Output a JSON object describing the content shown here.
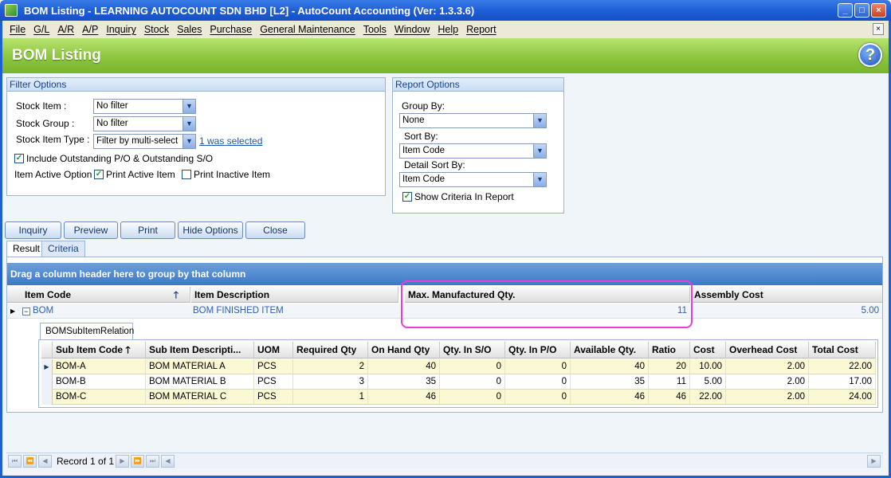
{
  "window": {
    "title": "BOM Listing - LEARNING AUTOCOUNT SDN BHD [L2] - AutoCount Accounting (Ver: 1.3.3.6)"
  },
  "menu": [
    "File",
    "G/L",
    "A/R",
    "A/P",
    "Inquiry",
    "Stock",
    "Sales",
    "Purchase",
    "General Maintenance",
    "Tools",
    "Window",
    "Help",
    "Report"
  ],
  "header": {
    "title": "BOM Listing"
  },
  "filter": {
    "title": "Filter Options",
    "stock_item_label": "Stock Item :",
    "stock_item_value": "No filter",
    "stock_group_label": "Stock Group :",
    "stock_group_value": "No filter",
    "stock_item_type_label": "Stock Item Type :",
    "stock_item_type_value": "Filter by multi-select",
    "selected_link": "1 was selected",
    "include_outstanding": "Include Outstanding P/O & Outstanding S/O",
    "item_active_label": "Item Active Option",
    "print_active": "Print Active Item",
    "print_inactive": "Print Inactive Item"
  },
  "report": {
    "title": "Report Options",
    "group_by_label": "Group By:",
    "group_by_value": "None",
    "sort_by_label": "Sort By:",
    "sort_by_value": "Item Code",
    "detail_sort_label": "Detail Sort By:",
    "detail_sort_value": "Item Code",
    "show_criteria": "Show Criteria In Report"
  },
  "buttons": {
    "inquiry": "Inquiry",
    "preview": "Preview",
    "print": "Print",
    "hide_options": "Hide Options",
    "close": "Close"
  },
  "tabs": {
    "result": "Result",
    "criteria": "Criteria"
  },
  "group_panel": "Drag a column header here to group by that column",
  "master": {
    "headers": [
      "Item Code",
      "Item Description",
      "Max. Manufactured Qty.",
      "Assembly Cost"
    ],
    "row": {
      "item_code": "BOM",
      "description": "BOM FINISHED ITEM",
      "max_qty": "11",
      "assembly_cost": "5.00"
    }
  },
  "sub": {
    "tab": "BOMSubItemRelation",
    "headers": [
      "Sub Item Code",
      "Sub Item Descripti...",
      "UOM",
      "Required Qty",
      "On Hand Qty",
      "Qty. In S/O",
      "Qty. In P/O",
      "Available Qty.",
      "Ratio",
      "Cost",
      "Overhead Cost",
      "Total Cost"
    ],
    "rows": [
      [
        "BOM-A",
        "BOM MATERIAL A",
        "PCS",
        "2",
        "40",
        "0",
        "0",
        "40",
        "20",
        "10.00",
        "2.00",
        "22.00"
      ],
      [
        "BOM-B",
        "BOM MATERIAL B",
        "PCS",
        "3",
        "35",
        "0",
        "0",
        "35",
        "11",
        "5.00",
        "2.00",
        "17.00"
      ],
      [
        "BOM-C",
        "BOM MATERIAL C",
        "PCS",
        "1",
        "46",
        "0",
        "0",
        "46",
        "46",
        "22.00",
        "2.00",
        "24.00"
      ]
    ]
  },
  "navigator": {
    "record_text": "Record 1 of 1"
  },
  "colors": {
    "title_blue": "#1f5fd6",
    "header_green": "#8cc63e",
    "highlight": "#e63fd8",
    "row_yellow": "#fbf9d4"
  }
}
